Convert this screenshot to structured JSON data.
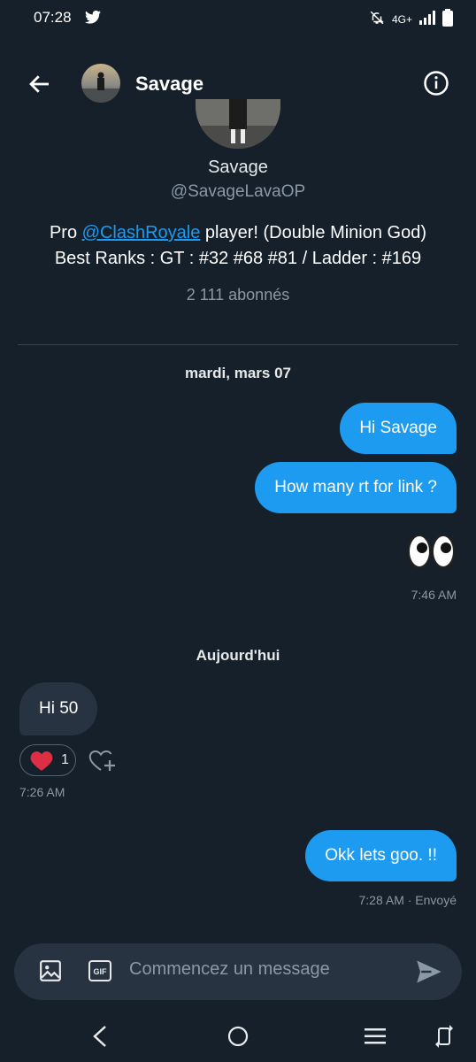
{
  "status_bar": {
    "time": "07:28",
    "network": "4G+"
  },
  "header": {
    "name": "Savage"
  },
  "profile": {
    "name": "Savage",
    "handle": "@SavageLavaOP",
    "bio_prefix": "Pro ",
    "bio_link": "@ClashRoyale",
    "bio_suffix": " player! (Double Minion God)",
    "bio_line2": "Best Ranks : GT : #32 #68 #81 / Ladder : #169",
    "followers": "2 111 abonnés"
  },
  "conversation": {
    "date_1": "mardi, mars 07",
    "sent_1": "Hi Savage",
    "sent_2": "How many rt for link ?",
    "sent_3_emoji": "eyes",
    "sent_time_1": "7:46 AM",
    "date_2": "Aujourd'hui",
    "received_1": "Hi 50",
    "reaction_count": "1",
    "received_time": "7:26 AM",
    "sent_4": "Okk lets goo. !!",
    "sent_time_2": "7:28 AM · Envoyé"
  },
  "composer": {
    "placeholder": "Commencez un message",
    "gif_label": "GIF"
  },
  "colors": {
    "background": "#15202b",
    "accent": "#1d9bf0",
    "bubble_in": "#273340",
    "muted": "#8b98a5"
  }
}
